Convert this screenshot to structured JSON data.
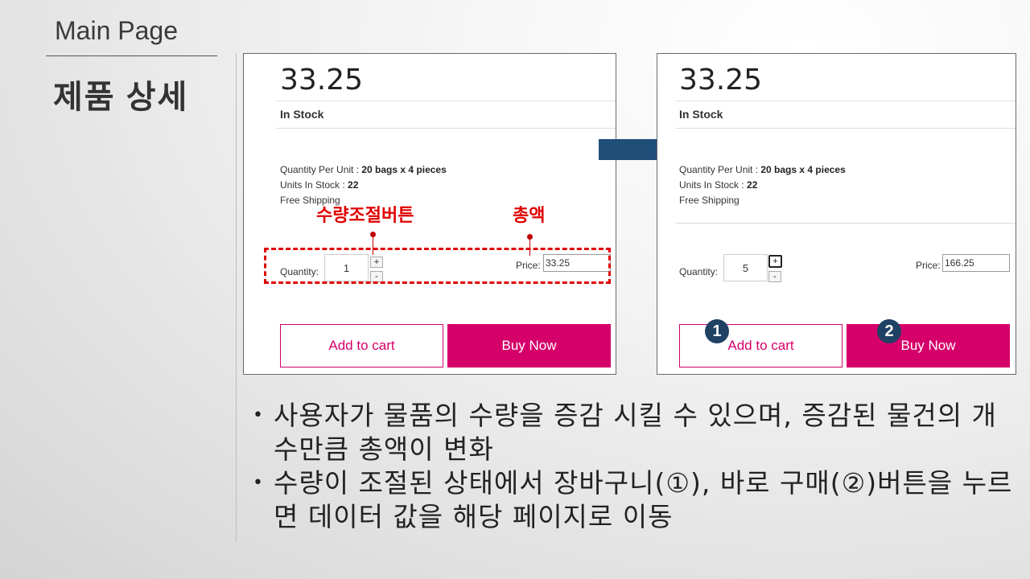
{
  "slide": {
    "title": "Main Page",
    "subtitle": "제품 상세"
  },
  "product_left": {
    "price": "33.25",
    "stock_status": "In Stock",
    "qty_per_unit_label": "Quantity Per Unit : ",
    "qty_per_unit_value": "20 bags x 4 pieces",
    "units_in_stock_label": "Units In Stock : ",
    "units_in_stock_value": "22",
    "shipping": "Free Shipping",
    "quantity_label": "Quantity:",
    "quantity_value": "1",
    "plus": "+",
    "minus": "-",
    "price_label": "Price:",
    "price_value": "33.25",
    "add_to_cart": "Add to cart",
    "buy_now": "Buy Now"
  },
  "product_right": {
    "price": "33.25",
    "stock_status": "In Stock",
    "qty_per_unit_label": "Quantity Per Unit : ",
    "qty_per_unit_value": "20 bags x 4 pieces",
    "units_in_stock_label": "Units In Stock : ",
    "units_in_stock_value": "22",
    "shipping": "Free Shipping",
    "quantity_label": "Quantity:",
    "quantity_value": "5",
    "plus": "+",
    "minus": "-",
    "price_label": "Price:",
    "price_value": "166.25",
    "add_to_cart": "Add to cart",
    "buy_now": "Buy Now",
    "marker_1": "1",
    "marker_2": "2"
  },
  "annotations": {
    "qty_button": "수량조절버튼",
    "total": "총액"
  },
  "bullets": [
    "사용자가 물품의 수량을 증감 시킬 수 있으며, 증감된 물건의 개수만큼 총액이 변화",
    "수량이 조절된 상태에서 장바구니(①), 바로 구매(②)버튼을 누르면 데이터 값을 해당 페이지로 이동"
  ],
  "colors": {
    "accent": "#d6006a",
    "annotation": "#e00000",
    "arrow": "#1f4e79",
    "marker": "#1f4164"
  }
}
